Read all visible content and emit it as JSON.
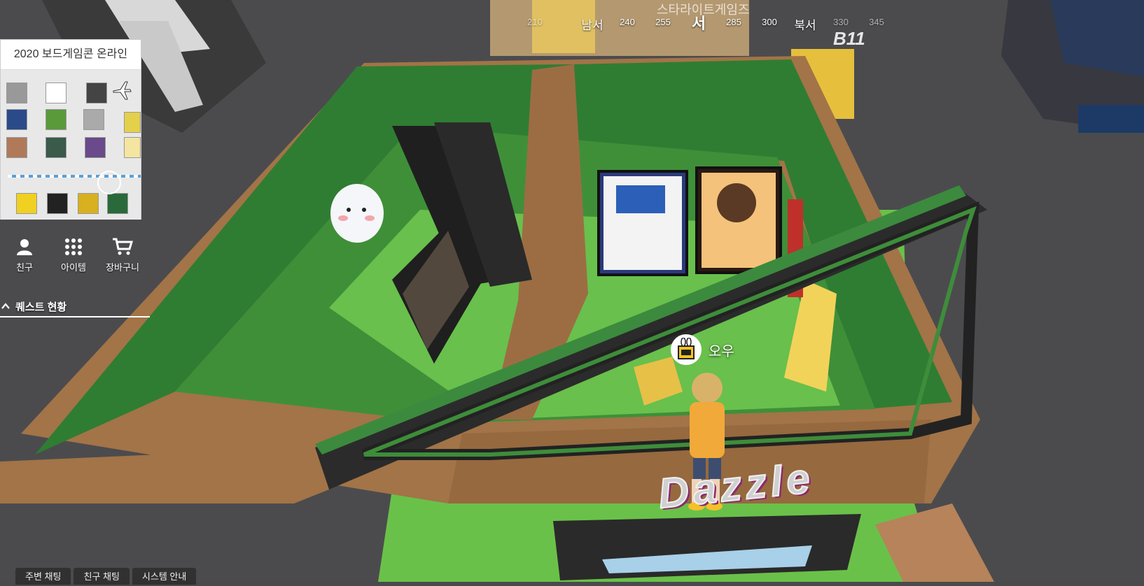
{
  "compass": {
    "ticks": [
      {
        "label": "210",
        "kind": "faded"
      },
      {
        "label": "남서",
        "kind": "dir"
      },
      {
        "label": "240",
        "kind": "num"
      },
      {
        "label": "255",
        "kind": "num"
      },
      {
        "label": "서",
        "kind": "main"
      },
      {
        "label": "285",
        "kind": "num"
      },
      {
        "label": "300",
        "kind": "num"
      },
      {
        "label": "북서",
        "kind": "dir"
      },
      {
        "label": "330",
        "kind": "faded"
      },
      {
        "label": "345",
        "kind": "faded"
      }
    ]
  },
  "minimap": {
    "title": "2020 보드게임콘 온라인"
  },
  "menu": {
    "friends": "친구",
    "items": "아이템",
    "cart": "장바구니"
  },
  "quest": {
    "label": "퀘스트 현황"
  },
  "player": {
    "name": "오우"
  },
  "chat": {
    "nearby": "주변 채팅",
    "friends": "친구 채팅",
    "system": "시스템 안내"
  },
  "scene": {
    "booth_sign": "스타라이트게임즈",
    "booth_number": "B11",
    "brand": "Dazzle"
  },
  "colors": {
    "floor": "#4a4a4c",
    "wall_green": "#2f7d32",
    "wood": "#9a6b42",
    "floor_green": "#6cc04a"
  }
}
